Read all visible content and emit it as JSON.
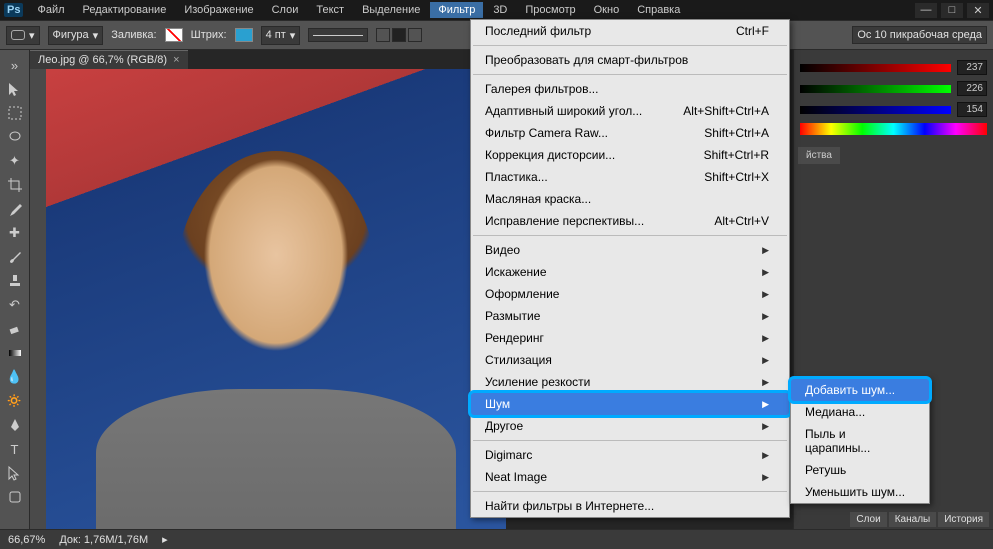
{
  "app": {
    "logo": "Ps"
  },
  "menubar": [
    "Файл",
    "Редактирование",
    "Изображение",
    "Слои",
    "Текст",
    "Выделение",
    "Фильтр",
    "3D",
    "Просмотр",
    "Окно",
    "Справка"
  ],
  "menubar_active_index": 6,
  "options": {
    "shape_label": "Фигура",
    "fill_label": "Заливка:",
    "stroke_label": "Штрих:",
    "stroke_width": "4 пт",
    "workspace": "Ос 10 пикрабочая среда"
  },
  "tab": {
    "title": "Лео.jpg @ 66,7% (RGB/8)"
  },
  "tools": [
    "move",
    "marquee",
    "lasso",
    "wand",
    "crop",
    "eyedropper",
    "healing",
    "brush",
    "stamp",
    "history",
    "eraser",
    "gradient",
    "blur",
    "dodge",
    "pen",
    "type",
    "path",
    "shape",
    "hand",
    "zoom"
  ],
  "status": {
    "zoom": "66,67%",
    "doc": "Док: 1,76M/1,76M"
  },
  "colors": {
    "r": "237",
    "g": "226",
    "b": "154"
  },
  "panel": {
    "tab": "йства"
  },
  "filter_menu": {
    "top": [
      {
        "label": "Последний фильтр",
        "short": "Ctrl+F"
      }
    ],
    "sec2": [
      {
        "label": "Преобразовать для смарт-фильтров"
      }
    ],
    "sec3": [
      {
        "label": "Галерея фильтров..."
      },
      {
        "label": "Адаптивный широкий угол...",
        "short": "Alt+Shift+Ctrl+A"
      },
      {
        "label": "Фильтр Camera Raw...",
        "short": "Shift+Ctrl+A"
      },
      {
        "label": "Коррекция дисторсии...",
        "short": "Shift+Ctrl+R"
      },
      {
        "label": "Пластика...",
        "short": "Shift+Ctrl+X"
      },
      {
        "label": "Масляная краска..."
      },
      {
        "label": "Исправление перспективы...",
        "short": "Alt+Ctrl+V"
      }
    ],
    "sec4": [
      {
        "label": "Видео",
        "sub": true
      },
      {
        "label": "Искажение",
        "sub": true
      },
      {
        "label": "Оформление",
        "sub": true
      },
      {
        "label": "Размытие",
        "sub": true
      },
      {
        "label": "Рендеринг",
        "sub": true
      },
      {
        "label": "Стилизация",
        "sub": true
      },
      {
        "label": "Усиление резкости",
        "sub": true
      },
      {
        "label": "Шум",
        "sub": true,
        "sel": true
      },
      {
        "label": "Другое",
        "sub": true
      }
    ],
    "sec5": [
      {
        "label": "Digimarc",
        "sub": true
      },
      {
        "label": "Neat Image",
        "sub": true
      }
    ],
    "sec6": [
      {
        "label": "Найти фильтры в Интернете..."
      }
    ]
  },
  "noise_submenu": [
    {
      "label": "Добавить шум...",
      "sel": true
    },
    {
      "label": "Медиана..."
    },
    {
      "label": "Пыль и царапины..."
    },
    {
      "label": "Ретушь"
    },
    {
      "label": "Уменьшить шум..."
    }
  ],
  "lower_panel_tabs": [
    "Слои",
    "Каналы",
    "История"
  ]
}
